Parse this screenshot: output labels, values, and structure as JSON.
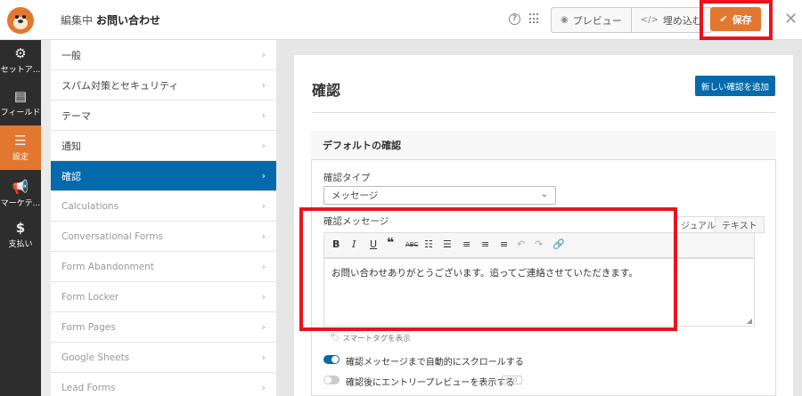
{
  "header": {
    "editing_prefix": "編集中",
    "form_name": "お問い合わせ",
    "help_icon": "?",
    "preview_label": "プレビュー",
    "embed_label": "埋め込む",
    "save_label": "保存"
  },
  "rail": {
    "items": [
      {
        "icon": "gear-icon",
        "label": "セットア..."
      },
      {
        "icon": "fields-icon",
        "label": "フィールド"
      },
      {
        "icon": "sliders-icon",
        "label": "設定"
      },
      {
        "icon": "megaphone-icon",
        "label": "マーケテ..."
      },
      {
        "icon": "dollar-icon",
        "label": "支払い"
      }
    ]
  },
  "menu": {
    "items": [
      {
        "label": "一般"
      },
      {
        "label": "スパム対策とセキュリティ"
      },
      {
        "label": "テーマ"
      },
      {
        "label": "通知"
      },
      {
        "label": "確認"
      },
      {
        "label": "Calculations"
      },
      {
        "label": "Conversational Forms"
      },
      {
        "label": "Form Abandonment"
      },
      {
        "label": "Form Locker"
      },
      {
        "label": "Form Pages"
      },
      {
        "label": "Google Sheets"
      },
      {
        "label": "Lead Forms"
      }
    ],
    "active_index": 4
  },
  "main": {
    "title": "確認",
    "add_button": "新しい確認を追加",
    "box_title": "デフォルトの確認",
    "type_label": "確認タイプ",
    "type_value": "メッセージ",
    "message_label": "確認メッセージ",
    "tab_visual": "ジュアル",
    "tab_text": "テキスト",
    "editor_text": "お問い合わせありがとうございます。追ってご連絡させていただきます。",
    "smart_tags": "スマートタグを表示",
    "toggle1_label": "確認メッセージまで自動的にスクロールする",
    "toggle2_label": "確認後にエントリープレビューを表示する",
    "pro_badge": "PRO"
  },
  "colors": {
    "accent": "#e27730",
    "primary": "#036aab",
    "highlight": "#e8141c",
    "rail": "#2d2d2d"
  }
}
